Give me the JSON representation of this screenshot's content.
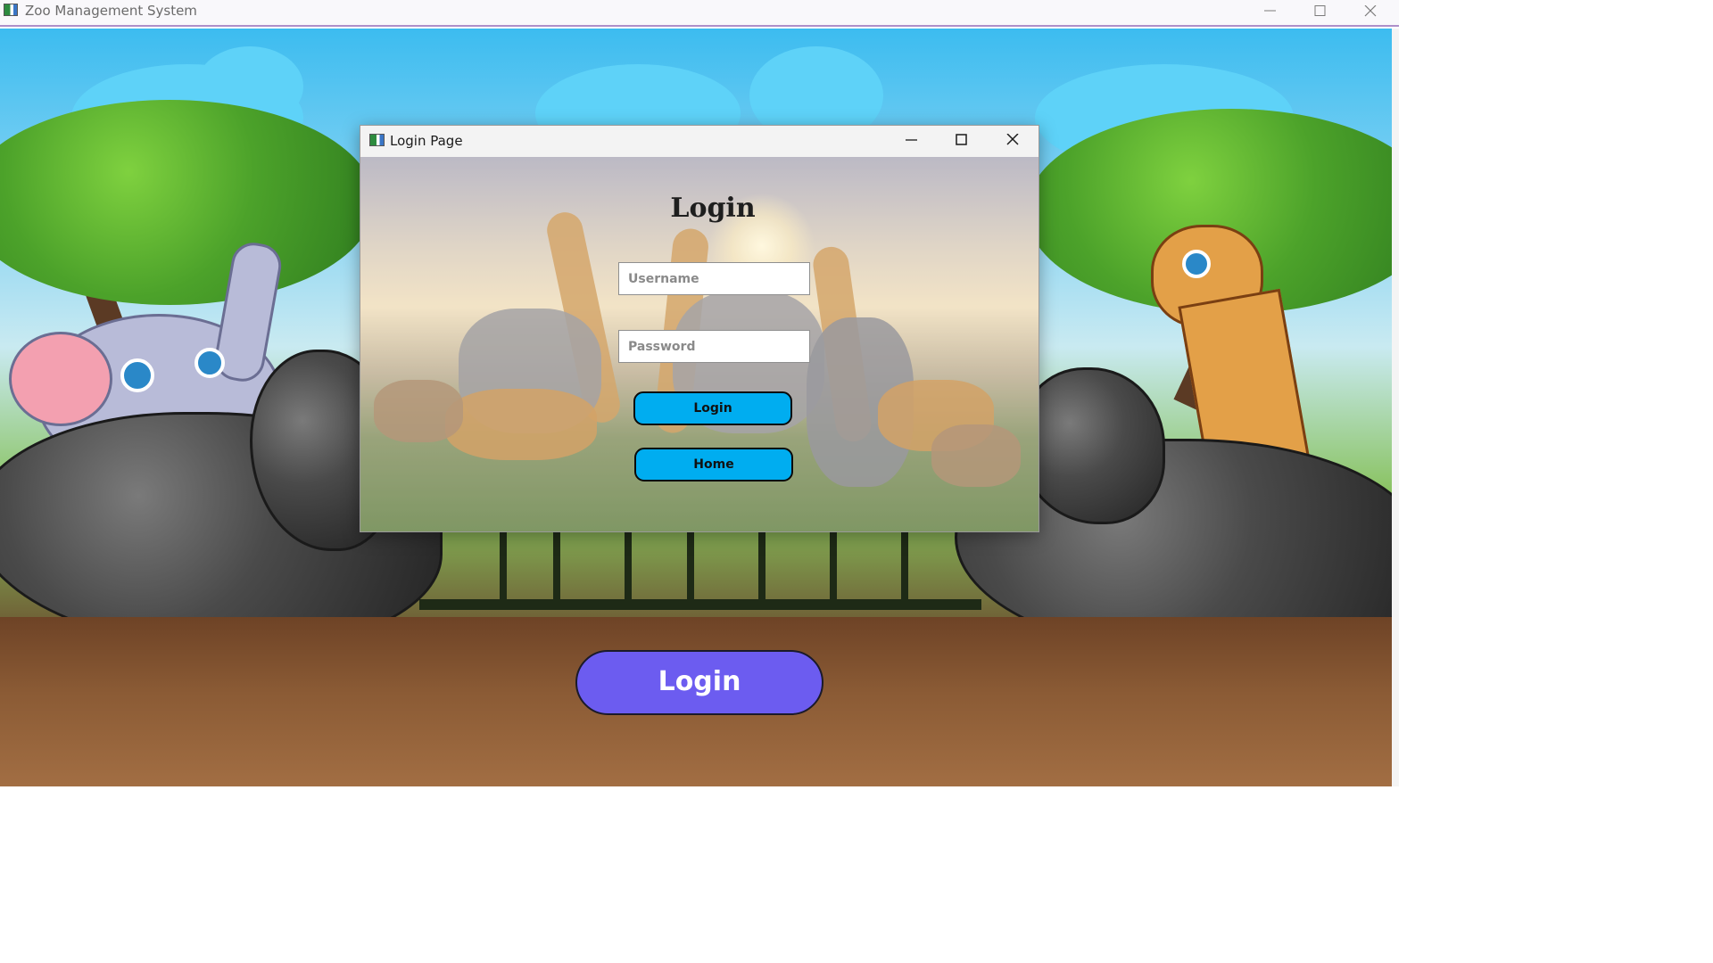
{
  "window": {
    "title": "Zoo Management System",
    "icon": "app-window-icon"
  },
  "dialog": {
    "title": "Login Page",
    "heading": "Login",
    "username_placeholder": "Username",
    "password_placeholder": "Password",
    "login_label": "Login",
    "home_label": "Home"
  },
  "main": {
    "login_label": "Login"
  },
  "colors": {
    "dialog_button": "#00adf0",
    "main_button": "#6c5cf0",
    "titlebar_accent": "#ad8fc9"
  }
}
